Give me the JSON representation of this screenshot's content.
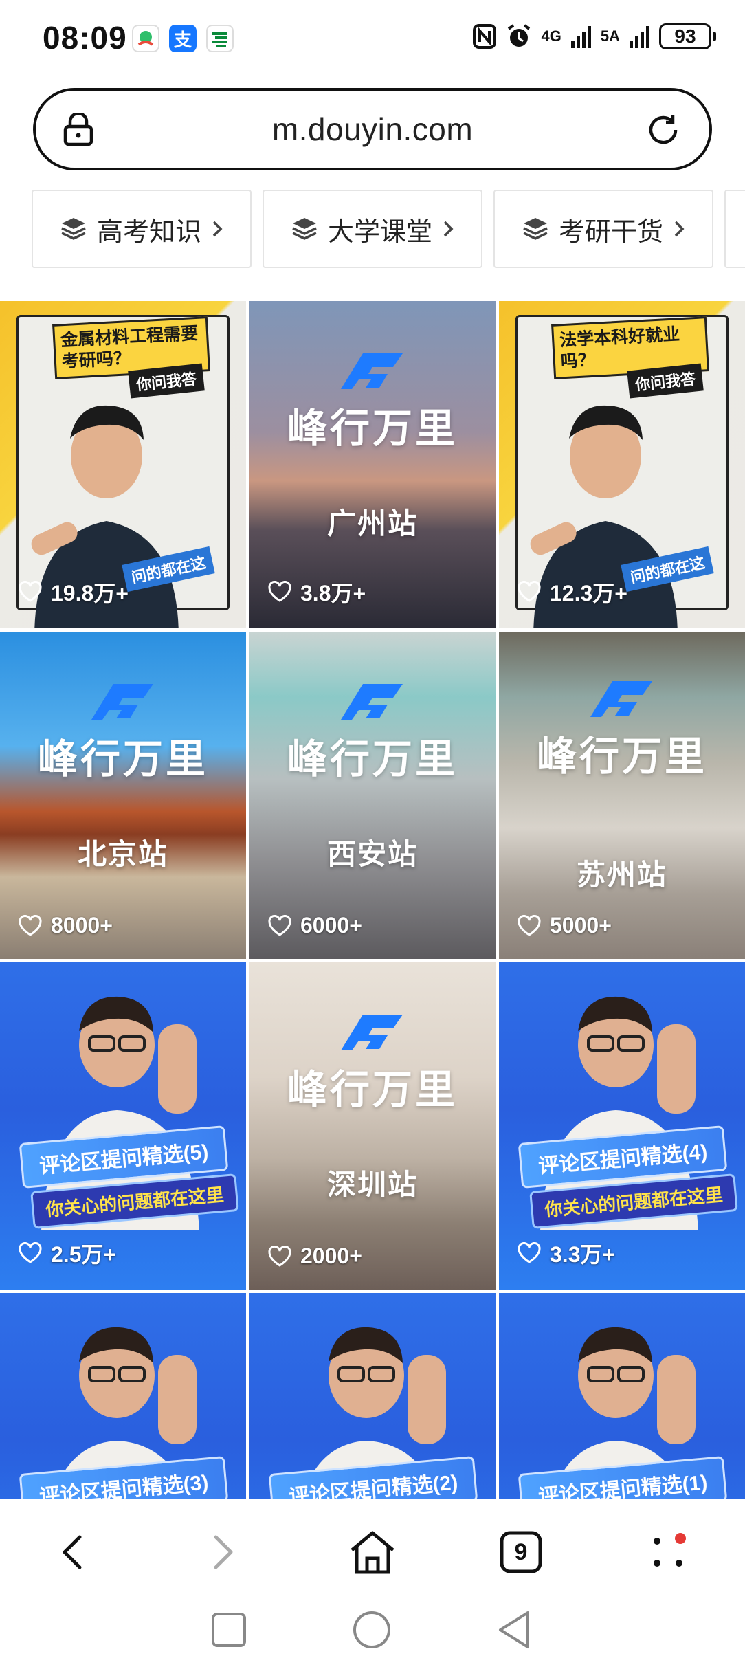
{
  "status_bar": {
    "time": "08:09",
    "network_1": "4G",
    "network_2": "5A",
    "battery": "93",
    "app_icons": [
      "weather-icon",
      "alipay-icon",
      "post-icon"
    ]
  },
  "browser": {
    "url": "m.douyin.com",
    "tabs_count": "9"
  },
  "categories": [
    {
      "label": "高考知识"
    },
    {
      "label": "大学课堂"
    },
    {
      "label": "考研干货"
    }
  ],
  "tiles": [
    {
      "kind": "yellow",
      "title": "金属材料工程需要考研吗？",
      "subtitle": "你问我答",
      "ribbon": "问的都在这",
      "likes": "19.8万+"
    },
    {
      "kind": "city",
      "brand": "峰行万里",
      "station": "广州站",
      "likes": "3.8万+"
    },
    {
      "kind": "yellow",
      "title": "法学本科好就业吗？",
      "subtitle": "你问我答",
      "ribbon": "问的都在这",
      "likes": "12.3万+"
    },
    {
      "kind": "city",
      "brand": "峰行万里",
      "station": "北京站",
      "likes": "8000+"
    },
    {
      "kind": "city",
      "brand": "峰行万里",
      "station": "西安站",
      "likes": "6000+"
    },
    {
      "kind": "city",
      "brand": "峰行万里",
      "station": "苏州站",
      "likes": "5000+"
    },
    {
      "kind": "blue",
      "title": "评论区提问精选(5)",
      "subtitle": "你关心的问题都在这里",
      "likes": "2.5万+"
    },
    {
      "kind": "city",
      "brand": "峰行万里",
      "station": "深圳站",
      "likes": "2000+"
    },
    {
      "kind": "blue",
      "title": "评论区提问精选(4)",
      "subtitle": "你关心的问题都在这里",
      "likes": "3.3万+"
    },
    {
      "kind": "blue",
      "title": "评论区提问精选(3)",
      "subtitle": "",
      "likes": ""
    },
    {
      "kind": "blue",
      "title": "评论区提问精选(2)",
      "subtitle": "",
      "likes": ""
    },
    {
      "kind": "blue",
      "title": "评论区提问精选(1)",
      "subtitle": "",
      "likes": ""
    }
  ],
  "bottom_nav": [
    "back-icon",
    "forward-icon",
    "home-icon",
    "tabs-icon",
    "menu-icon"
  ],
  "colors": {
    "accent_blue": "#2a76d6",
    "poster_yellow": "#f8d43e",
    "notification_red": "#e53935"
  }
}
